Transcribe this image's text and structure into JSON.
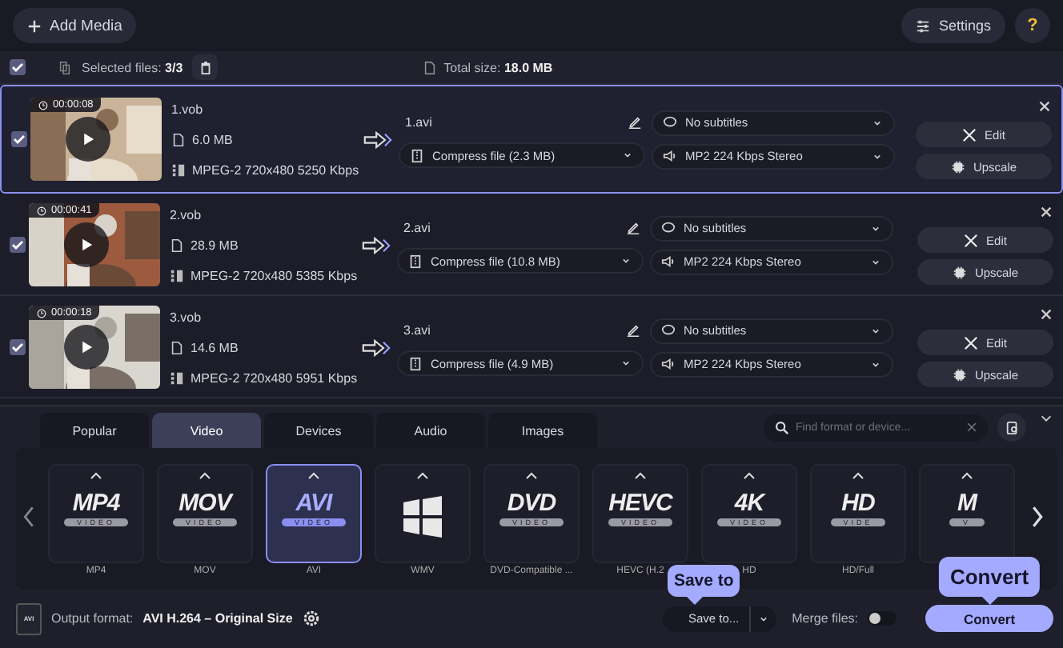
{
  "toolbar": {
    "add_media": "Add Media",
    "settings": "Settings",
    "help": "?"
  },
  "selection_bar": {
    "checked": true,
    "selected_files": "Selected files: **3/3**",
    "total_size": "Total size: **18.0 MB**"
  },
  "files": [
    {
      "selected": true,
      "checked": true,
      "duration": "00:00:08",
      "name": "1.vob",
      "size": "6.0 MB",
      "codec": "MPEG-2 720x480 5250 Kbps",
      "output_name": "1.avi",
      "compress": "Compress file (2.3 MB)",
      "subtitles": "No subtitles",
      "audio": "MP2 224 Kbps Stereo",
      "edit": "Edit",
      "upscale": "Upscale"
    },
    {
      "selected": false,
      "checked": true,
      "duration": "00:00:41",
      "name": "2.vob",
      "size": "28.9 MB",
      "codec": "MPEG-2 720x480 5385 Kbps",
      "output_name": "2.avi",
      "compress": "Compress file (10.8 MB)",
      "subtitles": "No subtitles",
      "audio": "MP2 224 Kbps Stereo",
      "edit": "Edit",
      "upscale": "Upscale"
    },
    {
      "selected": false,
      "checked": true,
      "duration": "00:00:18",
      "name": "3.vob",
      "size": "14.6 MB",
      "codec": "MPEG-2 720x480 5951 Kbps",
      "output_name": "3.avi",
      "compress": "Compress file (4.9 MB)",
      "subtitles": "No subtitles",
      "audio": "MP2 224 Kbps Stereo",
      "edit": "Edit",
      "upscale": "Upscale"
    }
  ],
  "format_tabs": [
    {
      "label": "Popular",
      "selected": false
    },
    {
      "label": "Video",
      "selected": true
    },
    {
      "label": "Devices",
      "selected": false
    },
    {
      "label": "Audio",
      "selected": false
    },
    {
      "label": "Images",
      "selected": false
    }
  ],
  "search": {
    "placeholder": "Find format or device..."
  },
  "formats": [
    {
      "kind": "text",
      "logo": "MP4",
      "badge": "VIDEO",
      "label": "MP4",
      "selected": false
    },
    {
      "kind": "text",
      "logo": "MOV",
      "badge": "VIDEO",
      "label": "MOV",
      "selected": false
    },
    {
      "kind": "text",
      "logo": "AVI",
      "badge": "VIDEO",
      "label": "AVI",
      "selected": true
    },
    {
      "kind": "windows",
      "label": "WMV",
      "selected": false
    },
    {
      "kind": "text",
      "logo": "DVD",
      "badge": "VIDEO",
      "label": "DVD-Compatible ...",
      "selected": false
    },
    {
      "kind": "text",
      "logo": "HEVC",
      "badge": "VIDEO",
      "label": "HEVC (H.2",
      "selected": false
    },
    {
      "kind": "text",
      "logo": "4K",
      "badge": "VIDEO",
      "label": "HD",
      "selected": false
    },
    {
      "kind": "text",
      "logo": "HD",
      "badge": "VIDE",
      "label": "HD/Full",
      "selected": false
    },
    {
      "kind": "text",
      "logo": "M",
      "badge": "V",
      "selected": false
    }
  ],
  "output": {
    "label": "Output format:",
    "value": "AVI H.264 – Original Size",
    "icon_text": "AVI"
  },
  "save_to": "Save to...",
  "merge": {
    "label": "Merge files:",
    "on": false
  },
  "convert": "Convert",
  "callouts": [
    {
      "kind": "save",
      "text": "Save to"
    },
    {
      "kind": "convert",
      "text": "Convert"
    }
  ]
}
